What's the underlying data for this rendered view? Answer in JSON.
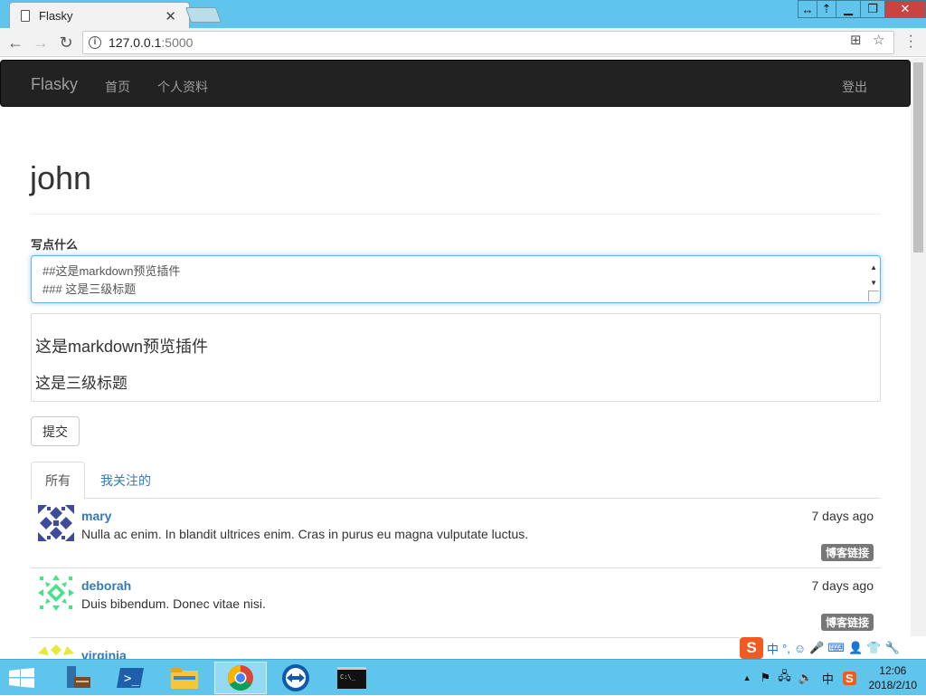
{
  "browser": {
    "tab_title": "Flasky",
    "url_host": "127.0.0.1",
    "url_port": ":5000"
  },
  "navbar": {
    "brand": "Flasky",
    "links": [
      "首页",
      "个人资料"
    ],
    "logout": "登出"
  },
  "page": {
    "title": "john",
    "form_label": "写点什么",
    "textarea_lines": [
      "##这是markdown预览插件",
      "### 这是三级标题"
    ],
    "preview": {
      "h2": "这是markdown预览插件",
      "h3": "这是三级标题"
    },
    "submit_label": "提交",
    "tabs": [
      "所有",
      "我关注的"
    ]
  },
  "posts": [
    {
      "author": "mary",
      "date": "7 days ago",
      "body": "Nulla ac enim. In blandit ultrices enim. Cras in purus eu magna vulputate luctus.",
      "badge": "博客链接"
    },
    {
      "author": "deborah",
      "date": "7 days ago",
      "body": "Duis bibendum. Donec vitae nisi.",
      "badge": "博客链接"
    },
    {
      "author": "virginia"
    }
  ],
  "ime": {
    "mode": "中",
    "punct": "°,"
  },
  "taskbar": {
    "ime_indicator": "中",
    "time": "12:06",
    "date": "2018/2/10"
  },
  "colors": {
    "link": "#337ab7",
    "navbar_bg": "#222222",
    "badge_bg": "#777777",
    "chrome_frame": "#5fc5ec"
  }
}
